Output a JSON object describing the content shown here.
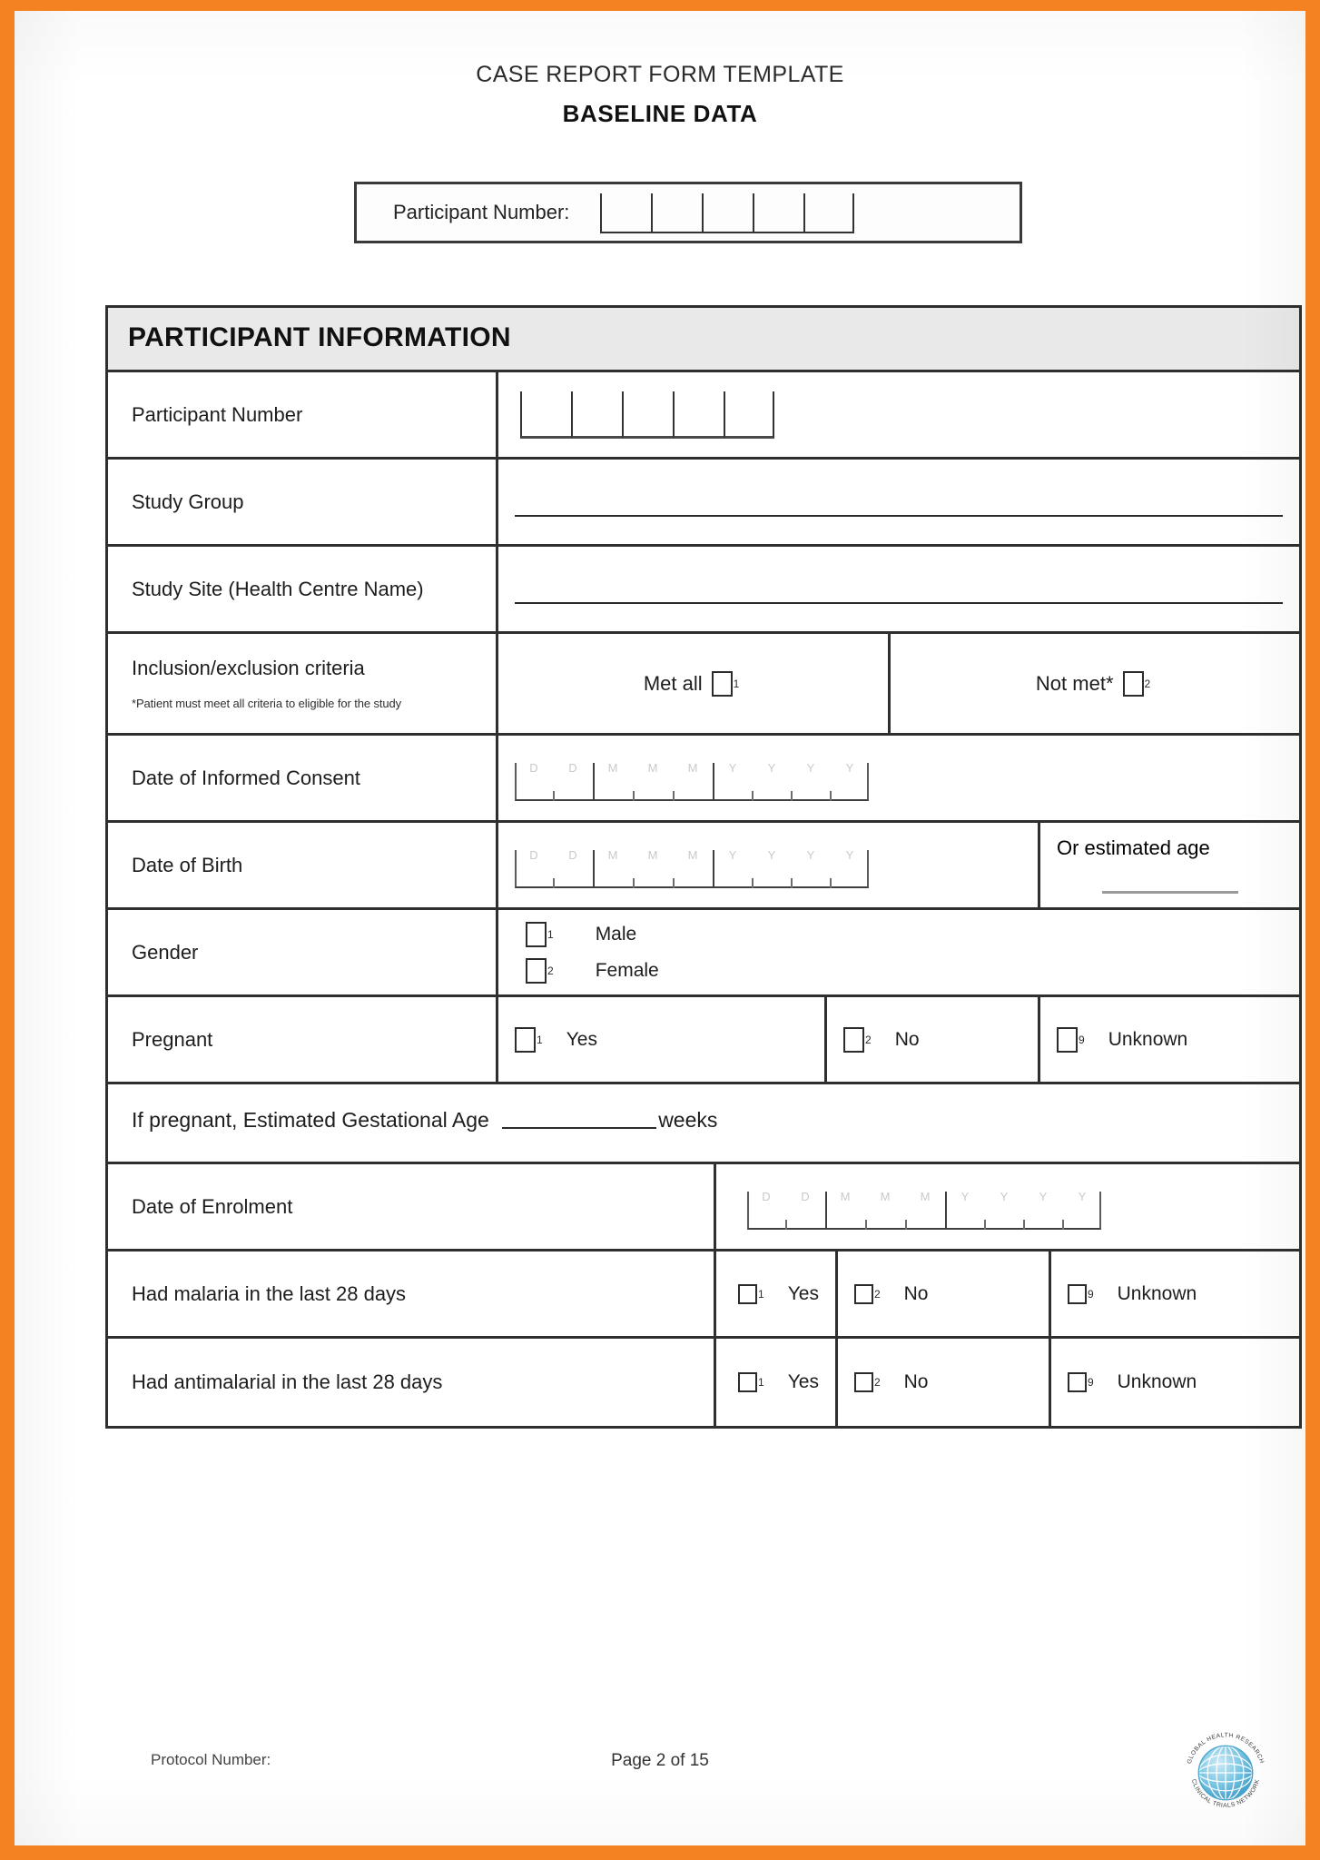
{
  "theme": {
    "border_color": "#f58220",
    "section_header_bg": "#e9e9e9",
    "rule_color": "#2f2f2f"
  },
  "header": {
    "title": "CASE REPORT FORM TEMPLATE",
    "subtitle": "BASELINE DATA",
    "participant_number_label": "Participant Number:",
    "participant_number_cells": 5
  },
  "section": {
    "title": "PARTICIPANT INFORMATION"
  },
  "rows": {
    "participant_number": {
      "label": "Participant Number",
      "cells": 5
    },
    "study_group": {
      "label": "Study Group",
      "value": ""
    },
    "study_site": {
      "label": "Study Site (Health Centre Name)",
      "value": ""
    },
    "criteria": {
      "label": "Inclusion/exclusion criteria",
      "note": "*Patient must meet all criteria to eligible for the study",
      "option_met": "Met all",
      "option_met_num": "1",
      "option_notmet": "Not met*",
      "option_notmet_num": "2"
    },
    "consent_date": {
      "label": "Date of Informed Consent",
      "format": "DD MMM YYYY"
    },
    "birth_date": {
      "label": "Date of Birth",
      "format": "DD MMM YYYY",
      "alt_label": "Or estimated age",
      "alt_value": ""
    },
    "gender": {
      "label": "Gender",
      "options": [
        {
          "num": "1",
          "text": "Male"
        },
        {
          "num": "2",
          "text": "Female"
        }
      ]
    },
    "pregnant": {
      "label": "Pregnant",
      "options": [
        {
          "num": "1",
          "text": "Yes"
        },
        {
          "num": "2",
          "text": "No"
        },
        {
          "num": "9",
          "text": "Unknown"
        }
      ]
    },
    "gestational": {
      "text_before": "If pregnant, Estimated Gestational Age",
      "value": "",
      "text_after": "weeks"
    },
    "enrolment_date": {
      "label": "Date of Enrolment",
      "format": "DD MMM YYYY"
    },
    "malaria": {
      "label": "Had malaria in the last 28 days",
      "options": [
        {
          "num": "1",
          "text": "Yes"
        },
        {
          "num": "2",
          "text": "No"
        },
        {
          "num": "9",
          "text": "Unknown"
        }
      ]
    },
    "antimalarial": {
      "label": "Had antimalarial in the last 28 days",
      "options": [
        {
          "num": "1",
          "text": "Yes"
        },
        {
          "num": "2",
          "text": "No"
        },
        {
          "num": "9",
          "text": "Unknown"
        }
      ]
    }
  },
  "date_ghost": {
    "d1": "D",
    "d2": "D",
    "m1": "M",
    "m2": "M",
    "m3": "M",
    "y1": "Y",
    "y2": "Y",
    "y3": "Y",
    "y4": "Y"
  },
  "footer": {
    "protocol_label": "Protocol Number:",
    "page_label": "Page 2 of 15",
    "logo_name": "globe-logo"
  }
}
